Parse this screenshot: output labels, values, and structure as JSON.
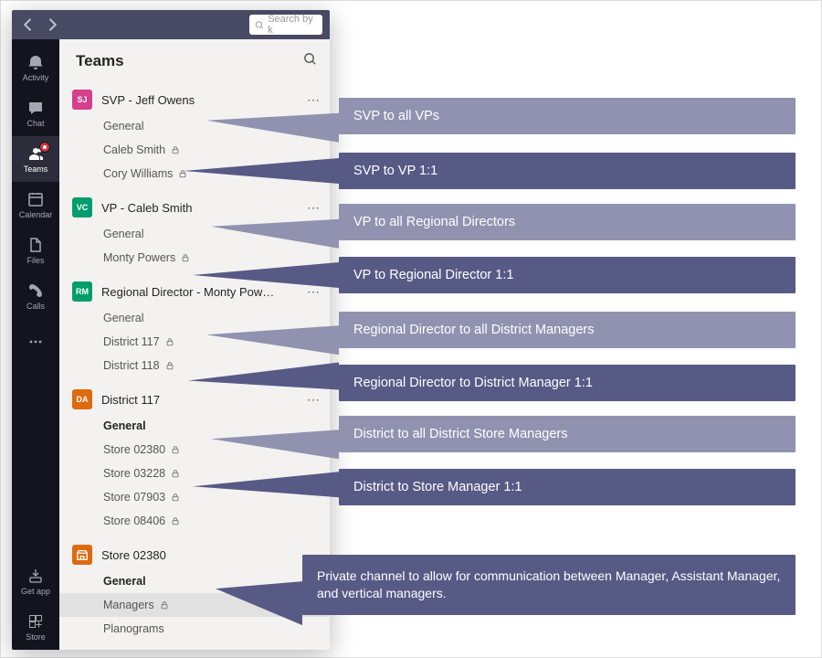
{
  "search": {
    "placeholder": "Search by k"
  },
  "rail": [
    {
      "id": "activity",
      "label": "Activity"
    },
    {
      "id": "chat",
      "label": "Chat"
    },
    {
      "id": "teams",
      "label": "Teams",
      "active": true,
      "badge": true
    },
    {
      "id": "calendar",
      "label": "Calendar"
    },
    {
      "id": "files",
      "label": "Files"
    },
    {
      "id": "calls",
      "label": "Calls"
    },
    {
      "id": "more",
      "label": ""
    }
  ],
  "rail_footer": [
    {
      "id": "getapp",
      "label": "Get app"
    },
    {
      "id": "store",
      "label": "Store"
    }
  ],
  "panel_title": "Teams",
  "teams": [
    {
      "name": "SVP - Jeff Owens",
      "avatar_bg": "#d53f8c",
      "initials": "SJ",
      "channels": [
        {
          "name": "General"
        },
        {
          "name": "Caleb Smith",
          "private": true
        },
        {
          "name": "Cory Williams",
          "private": true
        }
      ]
    },
    {
      "name": "VP - Caleb Smith",
      "avatar_bg": "#009e6d",
      "initials": "VC",
      "channels": [
        {
          "name": "General"
        },
        {
          "name": "Monty Powers",
          "private": true
        }
      ]
    },
    {
      "name": "Regional Director - Monty Pow…",
      "avatar_bg": "#009e6d",
      "initials": "RM",
      "channels": [
        {
          "name": "General"
        },
        {
          "name": "District 117",
          "private": true
        },
        {
          "name": "District 118",
          "private": true
        }
      ]
    },
    {
      "name": "District 117",
      "avatar_bg": "#de6a10",
      "initials": "DA",
      "channels": [
        {
          "name": "General",
          "bold": true
        },
        {
          "name": "Store 02380",
          "private": true
        },
        {
          "name": "Store 03228",
          "private": true
        },
        {
          "name": "Store 07903",
          "private": true
        },
        {
          "name": "Store 08406",
          "private": true
        }
      ]
    },
    {
      "name": "Store 02380",
      "store_icon": true,
      "initials": "",
      "channels": [
        {
          "name": "General",
          "bold": true
        },
        {
          "name": "Managers",
          "private": true,
          "selected": true
        },
        {
          "name": "Planograms"
        }
      ]
    }
  ],
  "callouts": [
    {
      "text": "SVP to all VPs",
      "light": true
    },
    {
      "text": "SVP to VP 1:1"
    },
    {
      "text": "VP to all Regional Directors",
      "light": true
    },
    {
      "text": "VP to Regional Director 1:1"
    },
    {
      "text": "Regional Director to all District Managers",
      "light": true
    },
    {
      "text": "Regional Director to District Manager 1:1"
    },
    {
      "text": "District to all District Store Managers",
      "light": true
    },
    {
      "text": "District to Store Manager 1:1"
    },
    {
      "text": "Private channel to allow for communication between Manager, Assistant Manager, and vertical managers.",
      "tall": true
    }
  ]
}
